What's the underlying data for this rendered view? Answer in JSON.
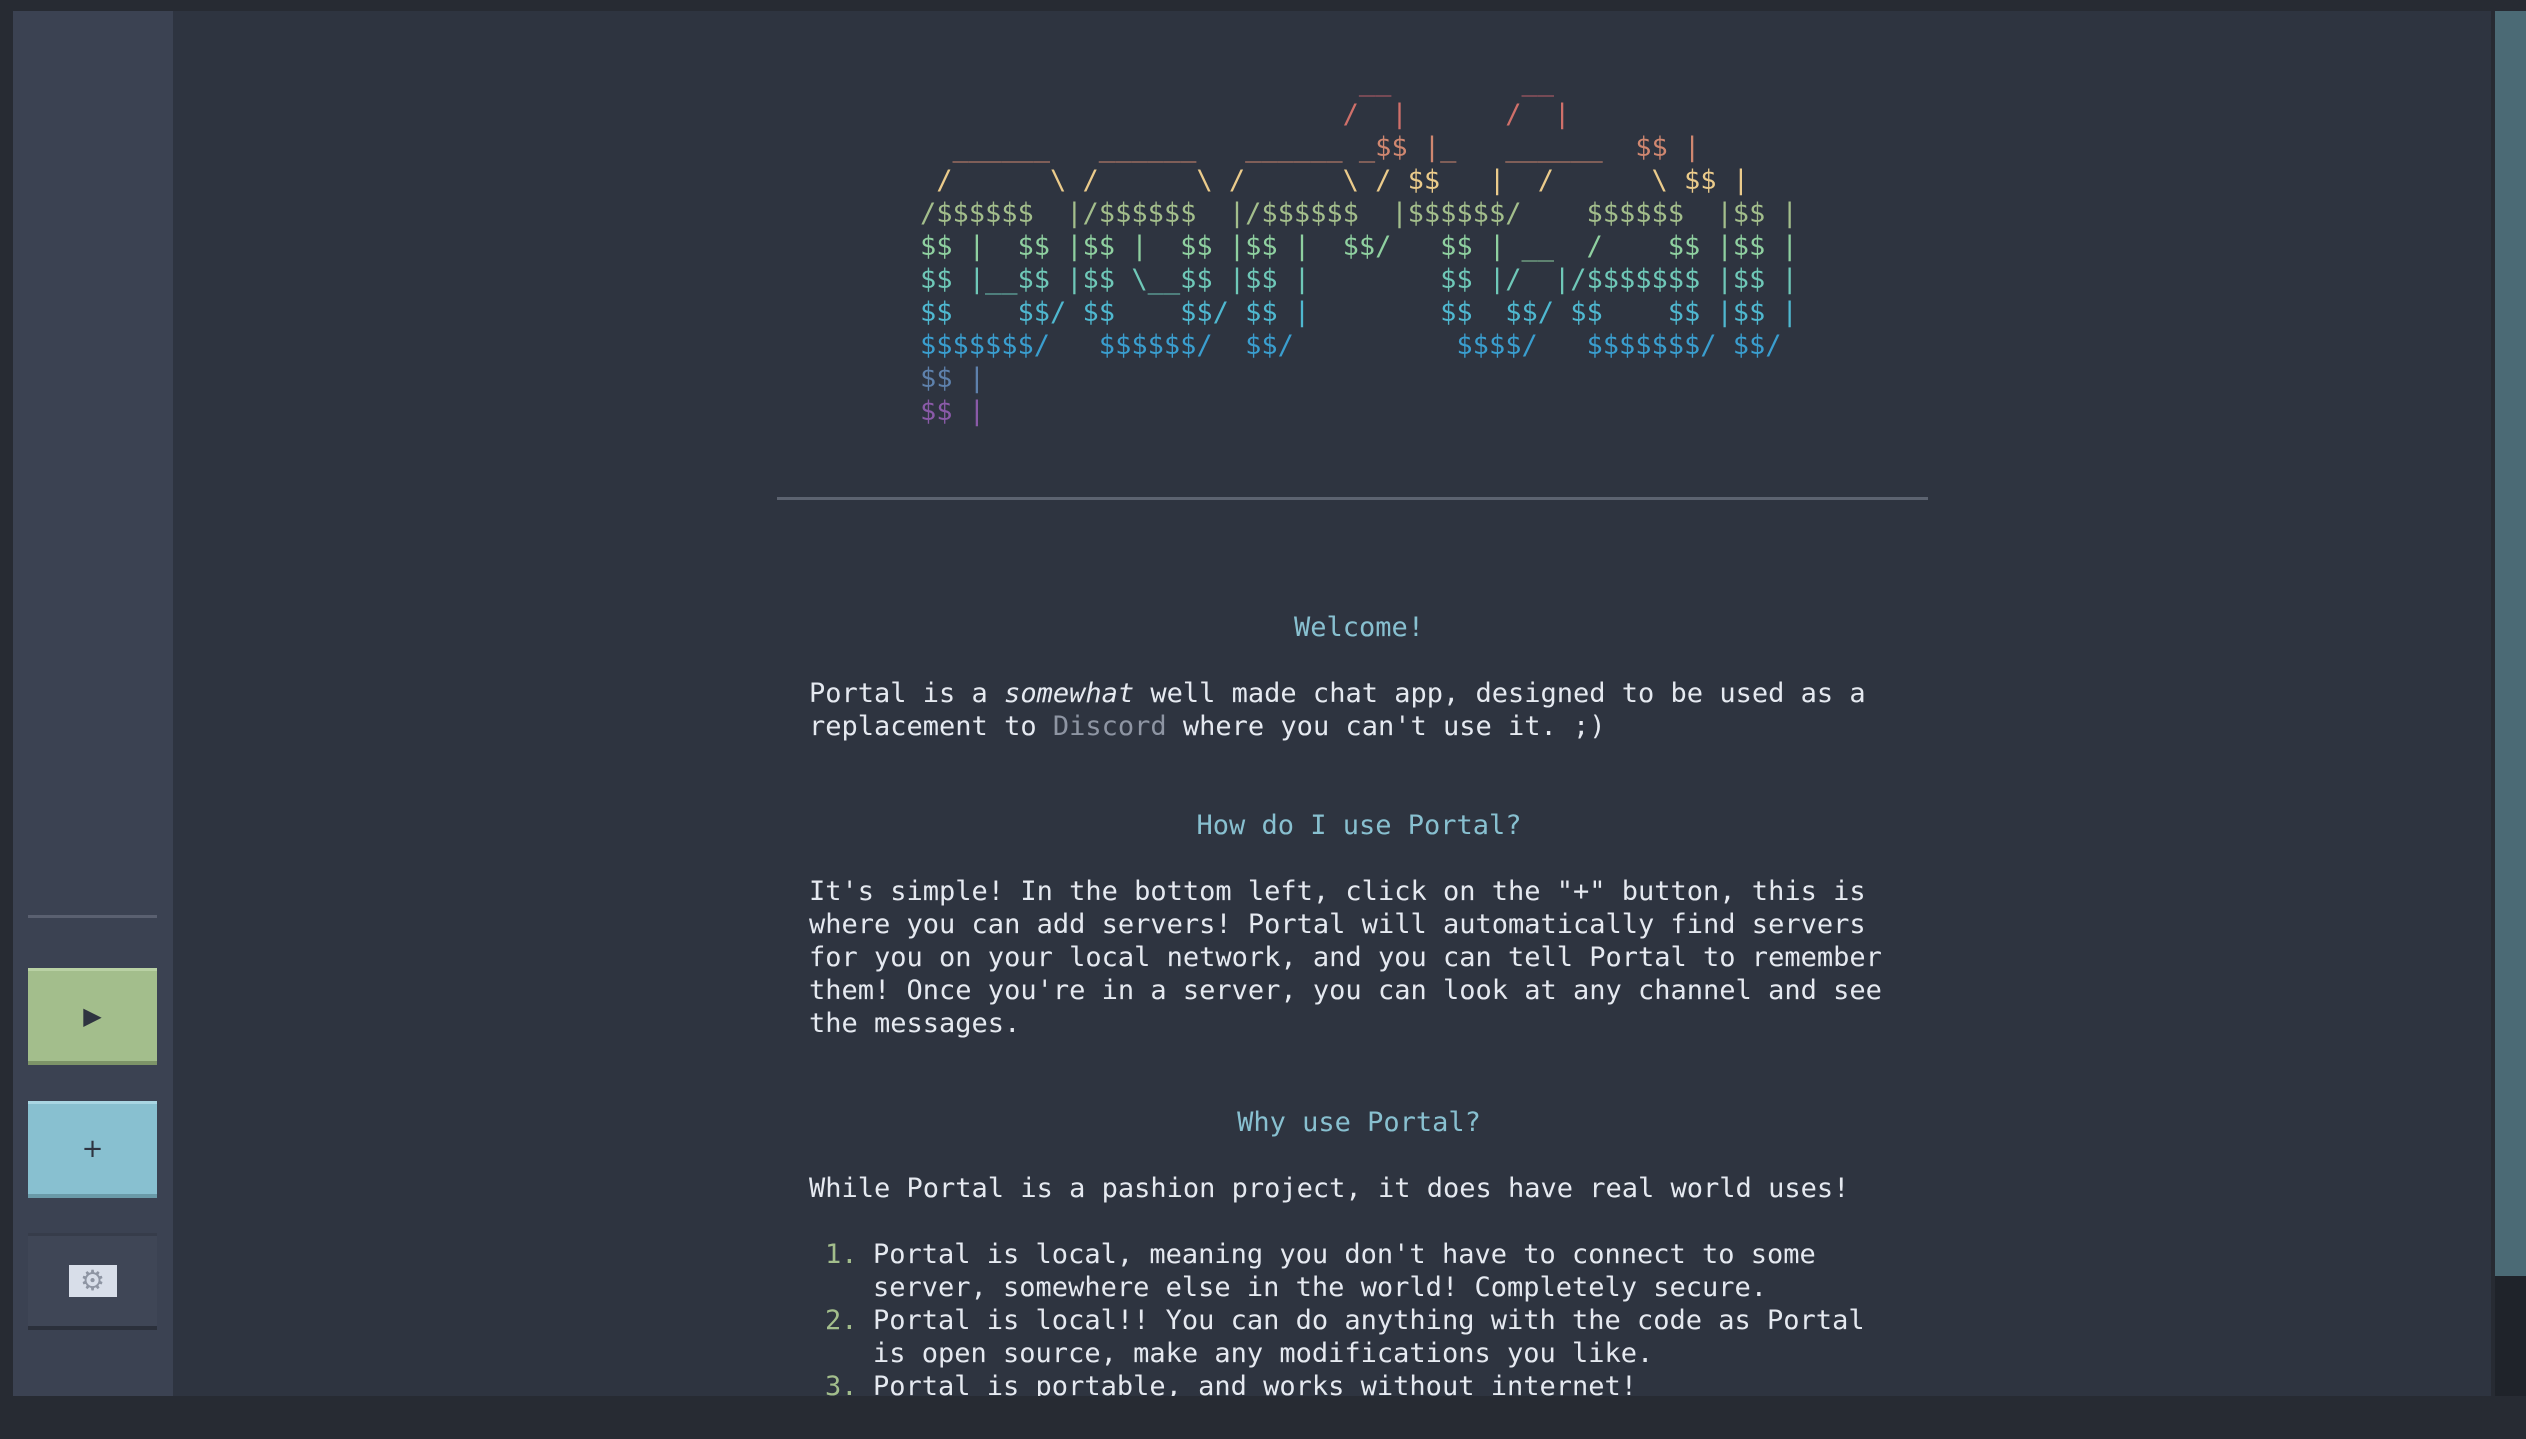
{
  "logo": {
    "ascii_lines": [
      "                           __        __",
      "                          /  |      /  |",
      "  ______   ______   ______ _$$ |_   ______  $$ |",
      " /      \\ /      \\ /      \\ / $$   |  /      \\ $$ |",
      "/$$$$$$  |/$$$$$$  |/$$$$$$  |$$$$$$/    $$$$$$  |$$ |",
      "$$ |  $$ |$$ |  $$ |$$ |  $$/   $$ | __  /    $$ |$$ |",
      "$$ |__$$ |$$ \\__$$ |$$ |        $$ |/  |/$$$$$$$ |$$ |",
      "$$    $$/ $$    $$/ $$ |        $$  $$/ $$    $$ |$$ |",
      "$$$$$$$/   $$$$$$/  $$/          $$$$/   $$$$$$$/ $$/",
      "$$ |",
      "$$ |"
    ],
    "line_colors": [
      "#bf616a",
      "#d0706a",
      "#d08770",
      "#ebcb8b",
      "#a3be8c",
      "#8fd0a0",
      "#6fc8b8",
      "#4fb8d0",
      "#3a9ecf",
      "#5e81ac",
      "#8a5aa8"
    ]
  },
  "sidebar": {
    "play_label": "▶",
    "add_label": "+",
    "settings_icon": "gear-icon"
  },
  "welcome": {
    "heading": "Welcome!",
    "intro_before": "Portal is a ",
    "intro_em": "somewhat",
    "intro_after": " well made chat app, designed to be used as a replacement to ",
    "intro_link": "Discord",
    "intro_end": " where you can't use it. ;)"
  },
  "howto": {
    "heading": "How do I use Portal?",
    "body": "It's simple! In the bottom left, click on the \"+\" button, this is where you can add servers! Portal will automatically find servers for you on your local network, and you can tell Portal to remember them! Once you're in a server, you can look at any channel and see the messages."
  },
  "why": {
    "heading": "Why use Portal?",
    "body": "While Portal is a pashion project, it does have real world uses!",
    "items": [
      {
        "num": "1.",
        "text": "Portal is local, meaning you don't have to connect to some server, somewhere else in the world! Completely secure."
      },
      {
        "num": "2.",
        "text": "Portal is local!! You can do anything with the code as Portal is open source, make any modifications you like."
      },
      {
        "num": "3.",
        "text": "Portal is portable, and works without internet!"
      }
    ]
  },
  "colors": {
    "background": "#2e3440",
    "sidebar": "#3b4252",
    "accent_green": "#a3be8c",
    "accent_blue": "#88c0d0",
    "text": "#e5e9f0"
  }
}
